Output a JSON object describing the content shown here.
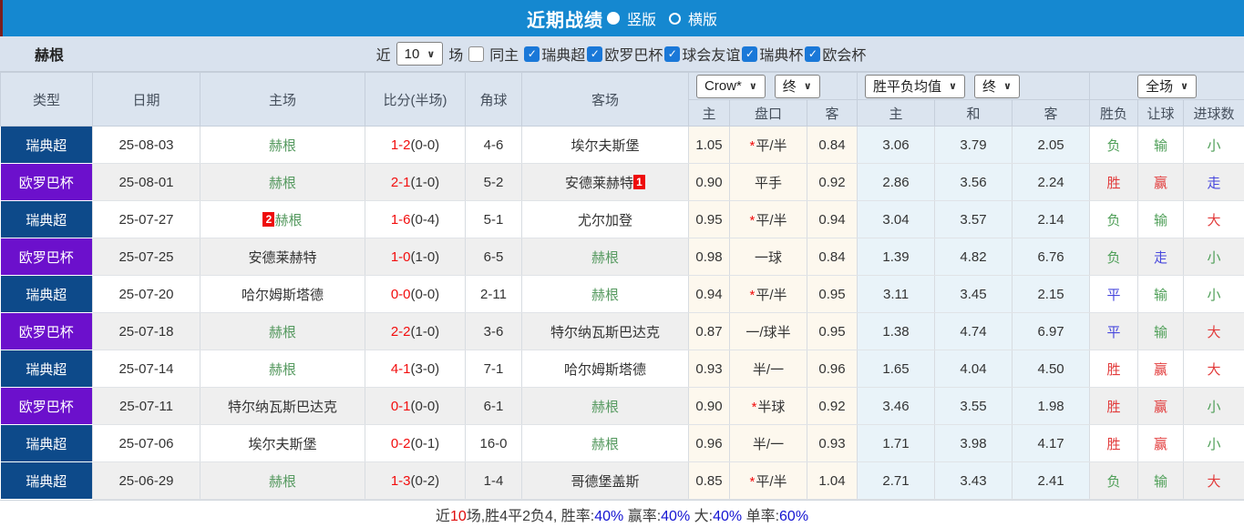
{
  "topbar": {
    "title": "近期战绩",
    "radio_vertical": "竖版",
    "radio_horizontal": "横版"
  },
  "filter": {
    "team": "赫根",
    "near_label": "近",
    "matches_value": "10",
    "matches_suffix": "场",
    "same_home_label": "同主",
    "leagues": [
      "瑞典超",
      "欧罗巴杯",
      "球会友谊",
      "瑞典杯",
      "欧会杯"
    ]
  },
  "header": {
    "type": "类型",
    "date": "日期",
    "home": "主场",
    "score": "比分(半场)",
    "corner": "角球",
    "away": "客场",
    "crow_select": "Crow*",
    "crow_period": "终",
    "avg_select": "胜平负均值",
    "avg_period": "终",
    "full_select": "全场",
    "sub": {
      "asian_home": "主",
      "asian_line": "盘口",
      "asian_away": "客",
      "avg_home": "主",
      "avg_draw": "和",
      "avg_away": "客",
      "result": "胜负",
      "handicap_result": "让球",
      "goals": "进球数"
    }
  },
  "colors": {
    "topbar": "#1588d0",
    "navy": "#0d4a8a",
    "purple": "#6c10cc",
    "team_green": "#55995f",
    "score_red": "#f20d0d",
    "result_red": "#e23b3b",
    "result_green": "#4f9f58",
    "result_blue": "#4848dd"
  },
  "rows": [
    {
      "league": "瑞典超",
      "league_color": "navy",
      "date": "25-08-03",
      "home": {
        "name": "赫根",
        "team": true
      },
      "score": {
        "full": "1-2",
        "half": "(0-0)"
      },
      "corners": "4-6",
      "away": {
        "name": "埃尔夫斯堡",
        "team": false
      },
      "asian": {
        "home": "1.05",
        "star": true,
        "line": "平/半",
        "away": "0.84"
      },
      "europe": {
        "home": "3.06",
        "draw": "3.79",
        "away": "2.05"
      },
      "results": {
        "outcome": {
          "text": "负",
          "color": "green"
        },
        "handicap": {
          "text": "输",
          "color": "green"
        },
        "goals": {
          "text": "小",
          "color": "green"
        }
      }
    },
    {
      "league": "欧罗巴杯",
      "league_color": "purple",
      "date": "25-08-01",
      "home": {
        "name": "赫根",
        "team": true
      },
      "score": {
        "full": "2-1",
        "half": "(1-0)"
      },
      "corners": "5-2",
      "away": {
        "name": "安德莱赫特",
        "team": false,
        "badge": "1",
        "badge_pos": "after"
      },
      "asian": {
        "home": "0.90",
        "star": false,
        "line": "平手",
        "away": "0.92"
      },
      "europe": {
        "home": "2.86",
        "draw": "3.56",
        "away": "2.24"
      },
      "results": {
        "outcome": {
          "text": "胜",
          "color": "red"
        },
        "handicap": {
          "text": "赢",
          "color": "red"
        },
        "goals": {
          "text": "走",
          "color": "blue"
        }
      }
    },
    {
      "league": "瑞典超",
      "league_color": "navy",
      "date": "25-07-27",
      "home": {
        "name": "赫根",
        "team": true,
        "badge": "2",
        "badge_pos": "before"
      },
      "score": {
        "full": "1-6",
        "half": "(0-4)"
      },
      "corners": "5-1",
      "away": {
        "name": "尤尔加登",
        "team": false
      },
      "asian": {
        "home": "0.95",
        "star": true,
        "line": "平/半",
        "away": "0.94"
      },
      "europe": {
        "home": "3.04",
        "draw": "3.57",
        "away": "2.14"
      },
      "results": {
        "outcome": {
          "text": "负",
          "color": "green"
        },
        "handicap": {
          "text": "输",
          "color": "green"
        },
        "goals": {
          "text": "大",
          "color": "red"
        }
      }
    },
    {
      "league": "欧罗巴杯",
      "league_color": "purple",
      "date": "25-07-25",
      "home": {
        "name": "安德莱赫特",
        "team": false
      },
      "score": {
        "full": "1-0",
        "half": "(1-0)"
      },
      "corners": "6-5",
      "away": {
        "name": "赫根",
        "team": true
      },
      "asian": {
        "home": "0.98",
        "star": false,
        "line": "一球",
        "away": "0.84"
      },
      "europe": {
        "home": "1.39",
        "draw": "4.82",
        "away": "6.76"
      },
      "results": {
        "outcome": {
          "text": "负",
          "color": "green"
        },
        "handicap": {
          "text": "走",
          "color": "blue"
        },
        "goals": {
          "text": "小",
          "color": "green"
        }
      }
    },
    {
      "league": "瑞典超",
      "league_color": "navy",
      "date": "25-07-20",
      "home": {
        "name": "哈尔姆斯塔德",
        "team": false
      },
      "score": {
        "full": "0-0",
        "half": "(0-0)"
      },
      "corners": "2-11",
      "away": {
        "name": "赫根",
        "team": true
      },
      "asian": {
        "home": "0.94",
        "star": true,
        "line": "平/半",
        "away": "0.95"
      },
      "europe": {
        "home": "3.11",
        "draw": "3.45",
        "away": "2.15"
      },
      "results": {
        "outcome": {
          "text": "平",
          "color": "blue"
        },
        "handicap": {
          "text": "输",
          "color": "green"
        },
        "goals": {
          "text": "小",
          "color": "green"
        }
      }
    },
    {
      "league": "欧罗巴杯",
      "league_color": "purple",
      "date": "25-07-18",
      "home": {
        "name": "赫根",
        "team": true
      },
      "score": {
        "full": "2-2",
        "half": "(1-0)"
      },
      "corners": "3-6",
      "away": {
        "name": "特尔纳瓦斯巴达克",
        "team": false
      },
      "asian": {
        "home": "0.87",
        "star": false,
        "line": "一/球半",
        "away": "0.95"
      },
      "europe": {
        "home": "1.38",
        "draw": "4.74",
        "away": "6.97"
      },
      "results": {
        "outcome": {
          "text": "平",
          "color": "blue"
        },
        "handicap": {
          "text": "输",
          "color": "green"
        },
        "goals": {
          "text": "大",
          "color": "red"
        }
      }
    },
    {
      "league": "瑞典超",
      "league_color": "navy",
      "date": "25-07-14",
      "home": {
        "name": "赫根",
        "team": true
      },
      "score": {
        "full": "4-1",
        "half": "(3-0)"
      },
      "corners": "7-1",
      "away": {
        "name": "哈尔姆斯塔德",
        "team": false
      },
      "asian": {
        "home": "0.93",
        "star": false,
        "line": "半/一",
        "away": "0.96"
      },
      "europe": {
        "home": "1.65",
        "draw": "4.04",
        "away": "4.50"
      },
      "results": {
        "outcome": {
          "text": "胜",
          "color": "red"
        },
        "handicap": {
          "text": "赢",
          "color": "red"
        },
        "goals": {
          "text": "大",
          "color": "red"
        }
      }
    },
    {
      "league": "欧罗巴杯",
      "league_color": "purple",
      "date": "25-07-11",
      "home": {
        "name": "特尔纳瓦斯巴达克",
        "team": false
      },
      "score": {
        "full": "0-1",
        "half": "(0-0)"
      },
      "corners": "6-1",
      "away": {
        "name": "赫根",
        "team": true
      },
      "asian": {
        "home": "0.90",
        "star": true,
        "line": "半球",
        "away": "0.92"
      },
      "europe": {
        "home": "3.46",
        "draw": "3.55",
        "away": "1.98"
      },
      "results": {
        "outcome": {
          "text": "胜",
          "color": "red"
        },
        "handicap": {
          "text": "赢",
          "color": "red"
        },
        "goals": {
          "text": "小",
          "color": "green"
        }
      }
    },
    {
      "league": "瑞典超",
      "league_color": "navy",
      "date": "25-07-06",
      "home": {
        "name": "埃尔夫斯堡",
        "team": false
      },
      "score": {
        "full": "0-2",
        "half": "(0-1)"
      },
      "corners": "16-0",
      "away": {
        "name": "赫根",
        "team": true
      },
      "asian": {
        "home": "0.96",
        "star": false,
        "line": "半/一",
        "away": "0.93"
      },
      "europe": {
        "home": "1.71",
        "draw": "3.98",
        "away": "4.17"
      },
      "results": {
        "outcome": {
          "text": "胜",
          "color": "red"
        },
        "handicap": {
          "text": "赢",
          "color": "red"
        },
        "goals": {
          "text": "小",
          "color": "green"
        }
      }
    },
    {
      "league": "瑞典超",
      "league_color": "navy",
      "date": "25-06-29",
      "home": {
        "name": "赫根",
        "team": true
      },
      "score": {
        "full": "1-3",
        "half": "(0-2)"
      },
      "corners": "1-4",
      "away": {
        "name": "哥德堡盖斯",
        "team": false
      },
      "asian": {
        "home": "0.85",
        "star": true,
        "line": "平/半",
        "away": "1.04"
      },
      "europe": {
        "home": "2.71",
        "draw": "3.43",
        "away": "2.41"
      },
      "results": {
        "outcome": {
          "text": "负",
          "color": "green"
        },
        "handicap": {
          "text": "输",
          "color": "green"
        },
        "goals": {
          "text": "大",
          "color": "red"
        }
      }
    }
  ],
  "footer": {
    "segments": [
      {
        "text": "近",
        "color": "dark"
      },
      {
        "text": "10",
        "color": "red"
      },
      {
        "text": "场,胜4平2负4, 胜率:",
        "color": "dark"
      },
      {
        "text": "40%",
        "color": "blue"
      },
      {
        "text": " 赢率:",
        "color": "dark"
      },
      {
        "text": "40%",
        "color": "blue"
      },
      {
        "text": " 大:",
        "color": "dark"
      },
      {
        "text": "40%",
        "color": "blue"
      },
      {
        "text": " 单率:",
        "color": "dark"
      },
      {
        "text": "60%",
        "color": "blue"
      }
    ]
  }
}
